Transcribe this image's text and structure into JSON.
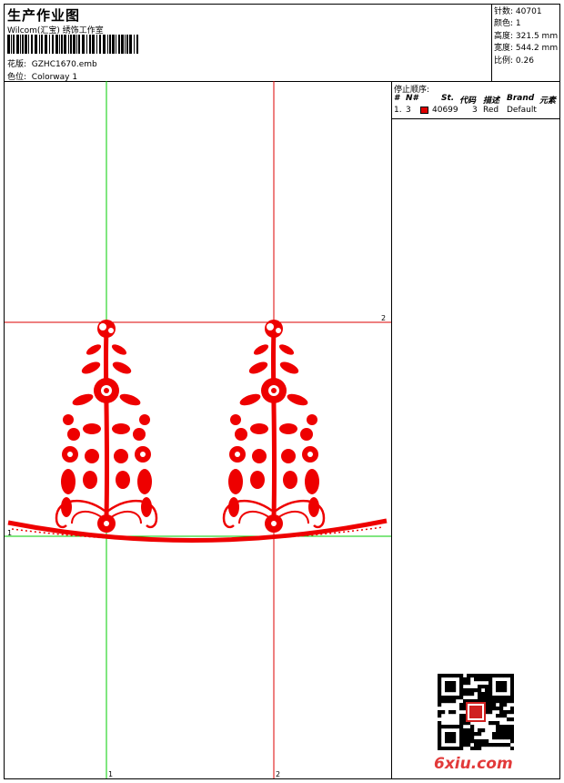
{
  "header": {
    "title": "生产作业图",
    "company": "Wilcom(汇宝) 绣饰工作室",
    "file_label": "花版:",
    "file_name": "GZHC1670.emb",
    "color_label": "色位:",
    "color_name": "Colorway 1"
  },
  "stats": {
    "stitches_label": "针数:",
    "stitches": "40701",
    "colors_label": "颜色:",
    "colors": "1",
    "height_label": "高度:",
    "height": "321.5 mm",
    "width_label": "宽度:",
    "width": "544.2 mm",
    "scale_label": "比例:",
    "scale": "0.26"
  },
  "stop_sequence": {
    "title": "停止顺序:",
    "headers": [
      "#",
      "N#",
      "St.",
      "代码",
      "描述",
      "Brand",
      "元素"
    ],
    "rows": [
      {
        "index": "1.",
        "needle": "3",
        "swatch_color": "#e00000",
        "stitches": "40699",
        "code": "3",
        "desc": "Red",
        "brand": "Default"
      }
    ]
  },
  "guides": {
    "label_1": "1",
    "label_2": "2",
    "label_3": "1",
    "label_4": "2"
  },
  "watermark": "6xiu.com",
  "colors": {
    "thread": "#ee0000",
    "guide_green": "#00cc00",
    "guide_red": "#dd0000"
  }
}
